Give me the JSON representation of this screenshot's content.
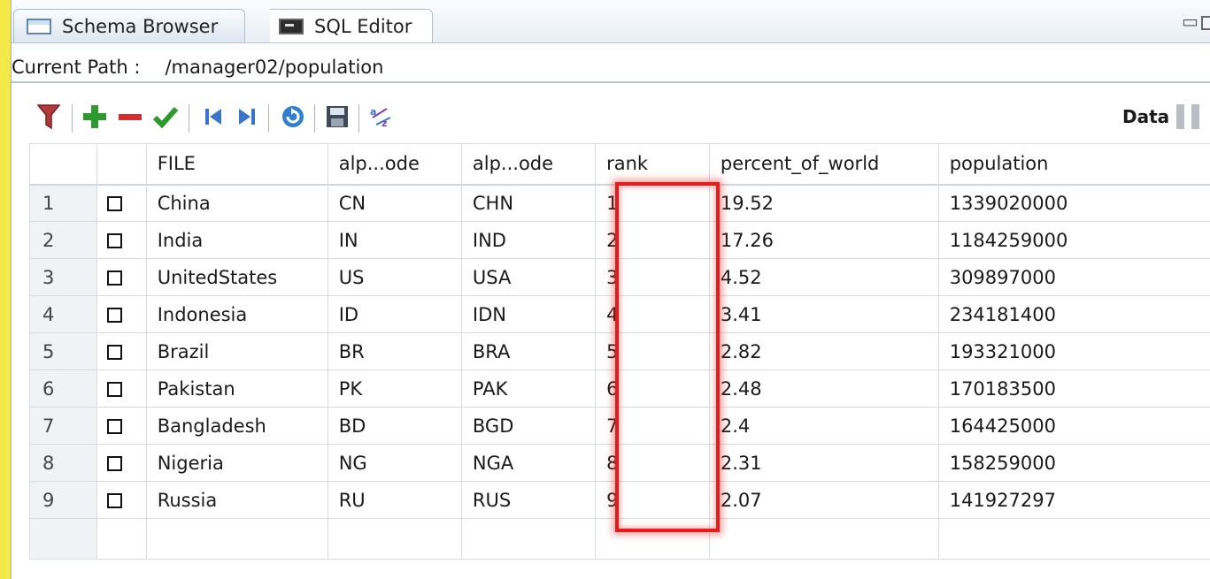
{
  "tabs": [
    {
      "label": "Schema Browser",
      "icon": "schema-browser-icon"
    },
    {
      "label": "SQL Editor",
      "icon": "sql-editor-icon"
    }
  ],
  "path": {
    "label": "Current Path :",
    "value": "/manager02/population"
  },
  "toolbar": {
    "data_label": "Data",
    "icons": [
      "filter-icon",
      "add-row-icon",
      "delete-row-icon",
      "commit-icon",
      "first-page-icon",
      "last-page-icon",
      "refresh-icon",
      "save-icon",
      "sort-icon",
      "pause-icon"
    ]
  },
  "grid": {
    "columns": [
      "",
      "",
      "FILE",
      "alp...ode",
      "alp...ode",
      "rank",
      "percent_of_world",
      "population"
    ],
    "rows": [
      {
        "n": "1",
        "file": "China",
        "a2": "CN",
        "a3": "CHN",
        "rank": "1",
        "pct": "19.52",
        "pop": "1339020000"
      },
      {
        "n": "2",
        "file": "India",
        "a2": "IN",
        "a3": "IND",
        "rank": "2",
        "pct": "17.26",
        "pop": "1184259000"
      },
      {
        "n": "3",
        "file": "UnitedStates",
        "a2": "US",
        "a3": "USA",
        "rank": "3",
        "pct": "4.52",
        "pop": "309897000"
      },
      {
        "n": "4",
        "file": "Indonesia",
        "a2": "ID",
        "a3": "IDN",
        "rank": "4",
        "pct": "3.41",
        "pop": "234181400"
      },
      {
        "n": "5",
        "file": "Brazil",
        "a2": "BR",
        "a3": "BRA",
        "rank": "5",
        "pct": "2.82",
        "pop": "193321000"
      },
      {
        "n": "6",
        "file": "Pakistan",
        "a2": "PK",
        "a3": "PAK",
        "rank": "6",
        "pct": "2.48",
        "pop": "170183500"
      },
      {
        "n": "7",
        "file": "Bangladesh",
        "a2": "BD",
        "a3": "BGD",
        "rank": "7",
        "pct": "2.4",
        "pop": "164425000"
      },
      {
        "n": "8",
        "file": "Nigeria",
        "a2": "NG",
        "a3": "NGA",
        "rank": "8",
        "pct": "2.31",
        "pop": "158259000"
      },
      {
        "n": "9",
        "file": "Russia",
        "a2": "RU",
        "a3": "RUS",
        "rank": "9",
        "pct": "2.07",
        "pop": "141927297"
      }
    ]
  },
  "colors": {
    "highlight": "#e61c1c",
    "background": "#f5e94a"
  }
}
